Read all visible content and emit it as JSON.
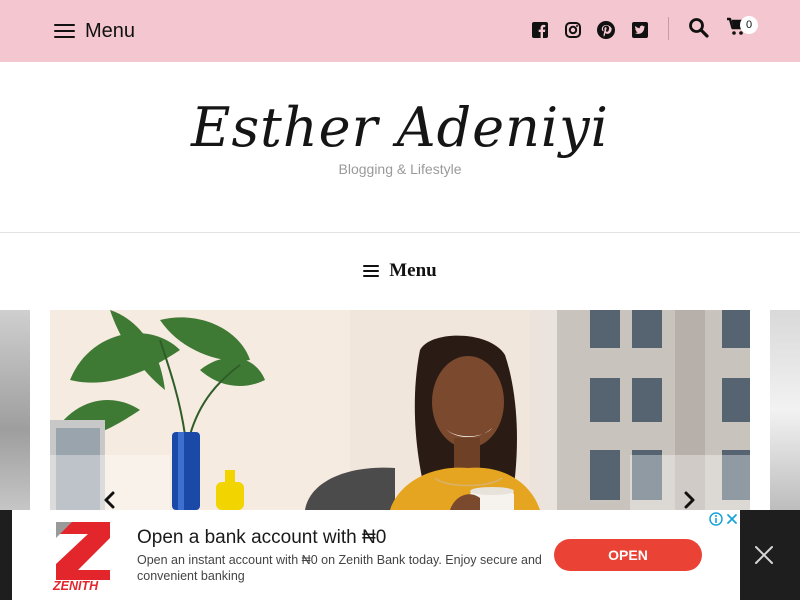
{
  "topbar": {
    "menu_label": "Menu",
    "background": "#f4c6cf",
    "social_icons": [
      "facebook-icon",
      "instagram-icon",
      "pinterest-icon",
      "twitter-icon"
    ],
    "search_icon": "search-icon",
    "cart_icon": "cart-icon",
    "cart_count": "0"
  },
  "header": {
    "site_title": "Esther Adeniyi",
    "tagline": "Blogging & Lifestyle"
  },
  "nav": {
    "menu_label": "Menu"
  },
  "slider": {
    "prev_icon": "chevron-left-icon",
    "next_icon": "chevron-right-icon"
  },
  "ad": {
    "brand": "ZENITH",
    "headline": "Open a bank account with ₦0",
    "body": "Open an instant account with ₦0 on Zenith Bank today. Enjoy secure and convenient banking",
    "cta_label": "OPEN",
    "cta_color": "#ea4335",
    "brand_color": "#e3262c"
  }
}
